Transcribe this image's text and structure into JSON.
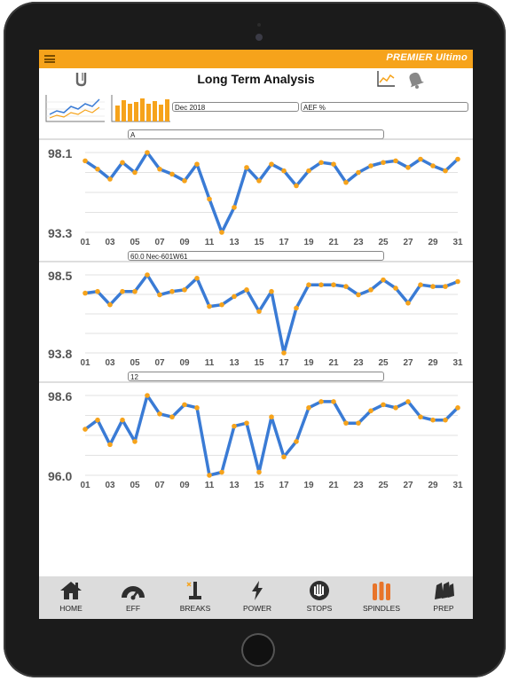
{
  "header": {
    "brand": "PREMIER Ultimo",
    "title": "Long Term Analysis"
  },
  "filters": {
    "period": "Dec 2018",
    "metric": "AEF %"
  },
  "colors": {
    "accent": "#f6a31b",
    "line": "#3a7bd5",
    "marker": "#f6a31b"
  },
  "chart_data": [
    {
      "type": "line",
      "label": "A",
      "ylim": [
        93.3,
        98.1
      ],
      "y_top_label": "98.1",
      "y_bottom_label": "93.3",
      "x_ticks": [
        "01",
        "03",
        "05",
        "07",
        "09",
        "11",
        "13",
        "15",
        "17",
        "19",
        "21",
        "23",
        "25",
        "27",
        "29",
        "31"
      ],
      "x": [
        1,
        2,
        3,
        4,
        5,
        6,
        7,
        8,
        9,
        10,
        11,
        12,
        13,
        14,
        15,
        16,
        17,
        18,
        19,
        20,
        21,
        22,
        23,
        24,
        25,
        26,
        27,
        28,
        29,
        30,
        31
      ],
      "values": [
        97.6,
        97.1,
        96.5,
        97.5,
        96.9,
        98.1,
        97.1,
        96.8,
        96.4,
        97.4,
        95.3,
        93.3,
        94.8,
        97.2,
        96.4,
        97.4,
        97.0,
        96.1,
        97.0,
        97.5,
        97.4,
        96.3,
        96.9,
        97.3,
        97.5,
        97.6,
        97.2,
        97.7,
        97.3,
        97.0,
        97.7
      ]
    },
    {
      "type": "line",
      "label": "60.0 Nec-601W61",
      "ylim": [
        93.8,
        98.5
      ],
      "y_top_label": "98.5",
      "y_bottom_label": "93.8",
      "x_ticks": [
        "01",
        "03",
        "05",
        "07",
        "09",
        "11",
        "13",
        "15",
        "17",
        "19",
        "21",
        "23",
        "25",
        "27",
        "29",
        "31"
      ],
      "x": [
        1,
        2,
        3,
        4,
        5,
        6,
        7,
        8,
        9,
        10,
        11,
        12,
        13,
        14,
        15,
        16,
        17,
        18,
        19,
        20,
        21,
        22,
        23,
        24,
        25,
        26,
        27,
        28,
        29,
        30,
        31
      ],
      "values": [
        97.4,
        97.5,
        96.7,
        97.5,
        97.5,
        98.5,
        97.3,
        97.5,
        97.6,
        98.3,
        96.6,
        96.7,
        97.2,
        97.6,
        96.3,
        97.5,
        93.8,
        96.5,
        97.9,
        97.9,
        97.9,
        97.8,
        97.3,
        97.6,
        98.2,
        97.7,
        96.8,
        97.9,
        97.8,
        97.8,
        98.1
      ]
    },
    {
      "type": "line",
      "label": "12",
      "ylim": [
        96.0,
        98.6
      ],
      "y_top_label": "98.6",
      "y_bottom_label": "96.0",
      "x_ticks": [
        "01",
        "03",
        "05",
        "07",
        "09",
        "11",
        "13",
        "15",
        "17",
        "19",
        "21",
        "23",
        "25",
        "27",
        "29",
        "31"
      ],
      "x": [
        1,
        2,
        3,
        4,
        5,
        6,
        7,
        8,
        9,
        10,
        11,
        12,
        13,
        14,
        15,
        16,
        17,
        18,
        19,
        20,
        21,
        22,
        23,
        24,
        25,
        26,
        27,
        28,
        29,
        30,
        31
      ],
      "values": [
        97.5,
        97.8,
        97.0,
        97.8,
        97.1,
        98.6,
        98.0,
        97.9,
        98.3,
        98.2,
        96.0,
        96.1,
        97.6,
        97.7,
        96.1,
        97.9,
        96.6,
        97.1,
        98.2,
        98.4,
        98.4,
        97.7,
        97.7,
        98.1,
        98.3,
        98.2,
        98.4,
        97.9,
        97.8,
        97.8,
        98.2
      ]
    }
  ],
  "nav": {
    "items": [
      {
        "label": "HOME",
        "icon": "home-icon"
      },
      {
        "label": "EFF",
        "icon": "gauge-icon"
      },
      {
        "label": "BREAKS",
        "icon": "breaks-icon"
      },
      {
        "label": "POWER",
        "icon": "lightning-icon"
      },
      {
        "label": "STOPS",
        "icon": "hand-stop-icon"
      },
      {
        "label": "SPINDLES",
        "icon": "spindles-icon"
      },
      {
        "label": "PREP",
        "icon": "prep-icon"
      }
    ]
  }
}
